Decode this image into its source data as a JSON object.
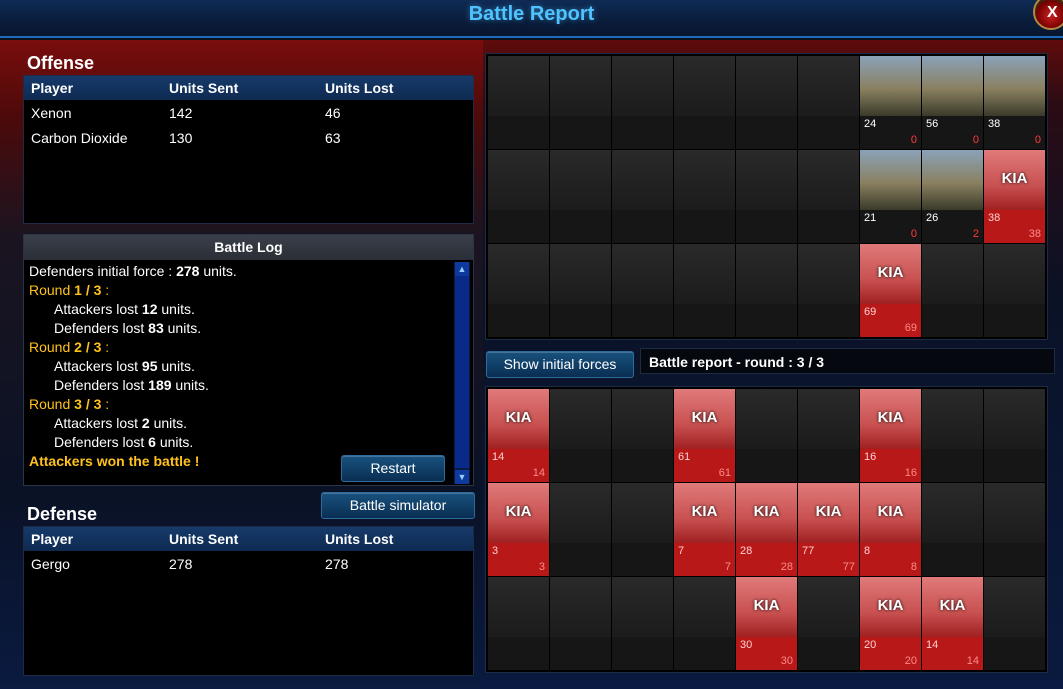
{
  "window": {
    "title": "Battle Report",
    "close_label": "X"
  },
  "offense": {
    "title": "Offense",
    "columns": [
      "Player",
      "Units Sent",
      "Units Lost"
    ],
    "rows": [
      {
        "player": "Xenon",
        "sent": "142",
        "lost": "46"
      },
      {
        "player": "Carbon Dioxide",
        "sent": "130",
        "lost": "63"
      }
    ]
  },
  "battle_log": {
    "title": "Battle Log",
    "initial_prefix": "Defenders initial force : ",
    "initial_value": "278",
    "initial_suffix": " units.",
    "rounds": [
      {
        "label_prefix": "Round ",
        "num": "1 / 3",
        "label_suffix": " :",
        "att_prefix": "Attackers lost ",
        "att": "12",
        "att_suffix": " units.",
        "def_prefix": "Defenders lost ",
        "def": "83",
        "def_suffix": " units."
      },
      {
        "label_prefix": "Round ",
        "num": "2 / 3",
        "label_suffix": " :",
        "att_prefix": "Attackers lost ",
        "att": "95",
        "att_suffix": " units.",
        "def_prefix": "Defenders lost ",
        "def": "189",
        "def_suffix": " units."
      },
      {
        "label_prefix": "Round ",
        "num": "3 / 3",
        "label_suffix": " :",
        "att_prefix": "Attackers lost ",
        "att": "2",
        "att_suffix": " units.",
        "def_prefix": "Defenders lost ",
        "def": "6",
        "def_suffix": " units."
      }
    ],
    "result": "Attackers won the battle !",
    "restart_label": "Restart"
  },
  "simulator_label": "Battle simulator",
  "defense": {
    "title": "Defense",
    "columns": [
      "Player",
      "Units Sent",
      "Units Lost"
    ],
    "rows": [
      {
        "player": "Gergo",
        "sent": "278",
        "lost": "278"
      }
    ]
  },
  "show_initial_label": "Show initial forces",
  "round_status": "Battle report - round : 3 / 3",
  "kia_label": "KIA",
  "attacker_grid": [
    [
      {},
      {},
      {},
      {},
      {},
      {},
      {
        "state": "active",
        "sent": "24",
        "lost": "0"
      },
      {
        "state": "active",
        "sent": "56",
        "lost": "0"
      },
      {
        "state": "active",
        "sent": "38",
        "lost": "0"
      }
    ],
    [
      {},
      {},
      {},
      {},
      {},
      {},
      {
        "state": "active",
        "sent": "21",
        "lost": "0"
      },
      {
        "state": "active",
        "sent": "26",
        "lost": "2"
      },
      {
        "state": "kia",
        "sent": "38",
        "lost": "38"
      }
    ],
    [
      {},
      {},
      {},
      {},
      {},
      {},
      {
        "state": "kia",
        "sent": "69",
        "lost": "69"
      },
      {},
      {}
    ]
  ],
  "defender_grid": [
    [
      {
        "state": "kia",
        "sent": "14",
        "lost": "14"
      },
      {},
      {},
      {
        "state": "kia",
        "sent": "61",
        "lost": "61"
      },
      {},
      {},
      {
        "state": "kia",
        "sent": "16",
        "lost": "16"
      },
      {},
      {}
    ],
    [
      {
        "state": "kia",
        "sent": "3",
        "lost": "3"
      },
      {},
      {},
      {
        "state": "kia",
        "sent": "7",
        "lost": "7"
      },
      {
        "state": "kia",
        "sent": "28",
        "lost": "28"
      },
      {
        "state": "kia",
        "sent": "77",
        "lost": "77"
      },
      {
        "state": "kia",
        "sent": "8",
        "lost": "8"
      },
      {},
      {}
    ],
    [
      {},
      {},
      {},
      {},
      {
        "state": "kia",
        "sent": "30",
        "lost": "30"
      },
      {},
      {
        "state": "kia",
        "sent": "20",
        "lost": "20"
      },
      {
        "state": "kia",
        "sent": "14",
        "lost": "14"
      },
      {}
    ]
  ]
}
